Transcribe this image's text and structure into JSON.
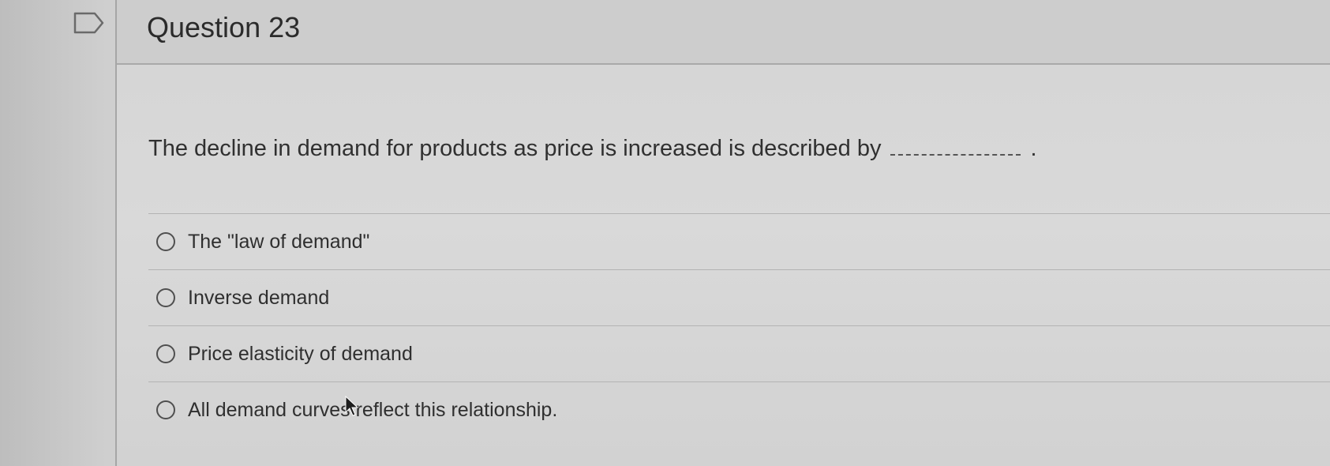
{
  "question": {
    "title": "Question 23",
    "prompt": "The decline in demand for products as price is increased is described by",
    "prompt_end": "."
  },
  "answers": [
    {
      "label": "The \"law of demand\""
    },
    {
      "label": "Inverse demand"
    },
    {
      "label": "Price elasticity of demand"
    },
    {
      "label": "All demand curves reflect this relationship."
    }
  ],
  "icons": {
    "flag": "flag-outline-icon",
    "cursor": "mouse-pointer-icon",
    "radio": "radio-unselected-icon"
  },
  "colors": {
    "background": "#d6d6d6",
    "text": "#2f2f2f",
    "divider": "#b3b3b3"
  }
}
